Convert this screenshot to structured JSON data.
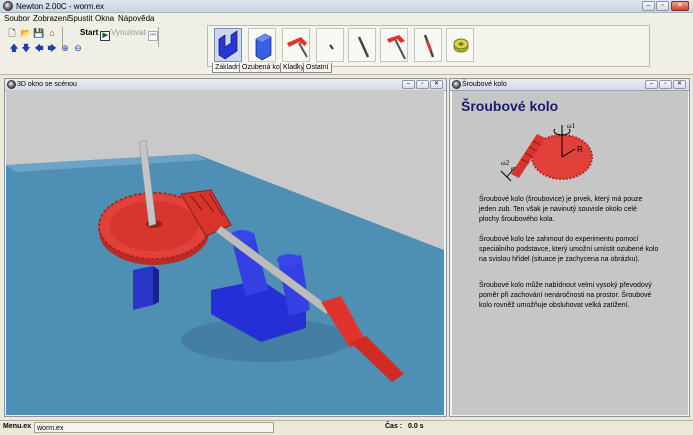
{
  "window": {
    "title": "Newton 2.00C - worm.ex"
  },
  "menu": [
    "Soubor",
    "Zobrazení",
    "Spustit",
    "Okna",
    "Nápověda"
  ],
  "toolbar": {
    "start_label": "Start",
    "reset_label": "Vynulovat"
  },
  "palette": {
    "parts": [
      "base-block-blue",
      "cube-blue",
      "crank-handle-red",
      "small-pin",
      "rod-dark",
      "crank-rod-red",
      "worm-screw",
      "gear-yellow"
    ],
    "tabs": [
      "Základní",
      "Ozubená kola",
      "Kladky",
      "Ostatní"
    ],
    "active_tab": "Základní"
  },
  "scene_window": {
    "title": "3D okno se scénou"
  },
  "info_window": {
    "title": "Šroubové kolo",
    "heading": "Šroubové kolo",
    "diagram_labels": {
      "omega1": "ω1",
      "omega2": "ω2",
      "radius": "R",
      "small_r": "r"
    },
    "paragraphs": [
      "Šroubové kolo (šroubovice) je prvek, který má pouze jeden zub. Ten však je navinutý souvisle okolo celé plochy šroubového kola.",
      "Šroubové kolo lze zahmout do experimentu pomocí speciálního podstavce, který umožní umístit ozubené kolo na svislou hřídel (situace je zachycena na obrázku).",
      "Šroubové kolo může nabídnout velmi vysoký převodový poměr při zachování nenáročnosti na prostor. Šroubové kolo rovněž umožňuje obsluhovat velká zatížení."
    ]
  },
  "statusbar": {
    "left_label": "Menu.ex",
    "file": "worm.ex",
    "time_label": "Čas :",
    "time_value": "0.0 s"
  },
  "colors": {
    "gear_red": "#e2403a",
    "base_blue": "#2833d8",
    "floor_blue": "#4f8fb4",
    "heading_navy": "#1a1a6e"
  }
}
